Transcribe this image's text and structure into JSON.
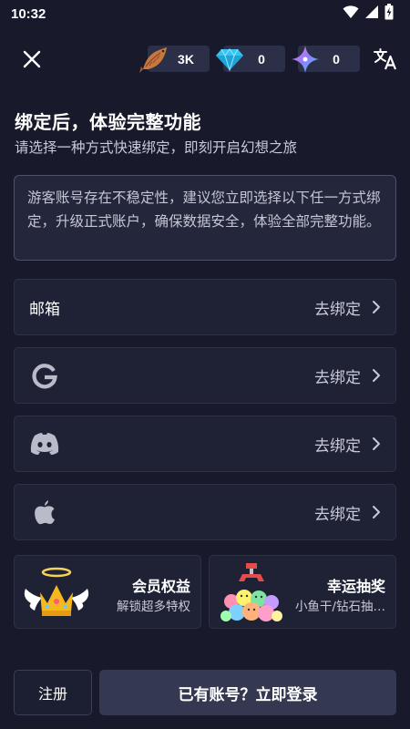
{
  "status_bar": {
    "time": "10:32",
    "icons": [
      "wifi-icon",
      "signal-icon",
      "battery-icon"
    ]
  },
  "top_bar": {
    "close_icon": "close-icon",
    "translate_icon": "translate-icon",
    "currencies": [
      {
        "name": "fish",
        "icon": "fish-icon",
        "value": "3K"
      },
      {
        "name": "diamond",
        "icon": "diamond-icon",
        "value": "0"
      },
      {
        "name": "star",
        "icon": "sparkle-star-icon",
        "value": "0"
      }
    ]
  },
  "heading": {
    "title": "绑定后，体验完整功能",
    "subtitle": "请选择一种方式快速绑定，即刻开启幻想之旅"
  },
  "notice": {
    "text": "游客账号存在不稳定性，建议您立即选择以下任一方式绑定，升级正式账户，确保数据安全，体验全部完整功能。"
  },
  "bind_options": [
    {
      "id": "email",
      "label": "邮箱",
      "icon": null,
      "action": "去绑定"
    },
    {
      "id": "google",
      "label": "",
      "icon": "google-icon",
      "action": "去绑定"
    },
    {
      "id": "discord",
      "label": "",
      "icon": "discord-icon",
      "action": "去绑定"
    },
    {
      "id": "apple",
      "label": "",
      "icon": "apple-icon",
      "action": "去绑定"
    }
  ],
  "promos": [
    {
      "id": "membership",
      "title": "会员权益",
      "subtitle": "解锁超多特权",
      "image": "winged-crown-image"
    },
    {
      "id": "lucky-draw",
      "title": "幸运抽奖",
      "subtitle": "小鱼干/钻石抽…",
      "image": "claw-machine-image"
    }
  ],
  "footer": {
    "register_label": "注册",
    "login_label": "已有账号？立即登录"
  },
  "colors": {
    "background": "#181a2c",
    "card": "#1f2235",
    "card_border": "#2d3047",
    "login_button": "#343850",
    "muted_text": "#c8cad8"
  }
}
